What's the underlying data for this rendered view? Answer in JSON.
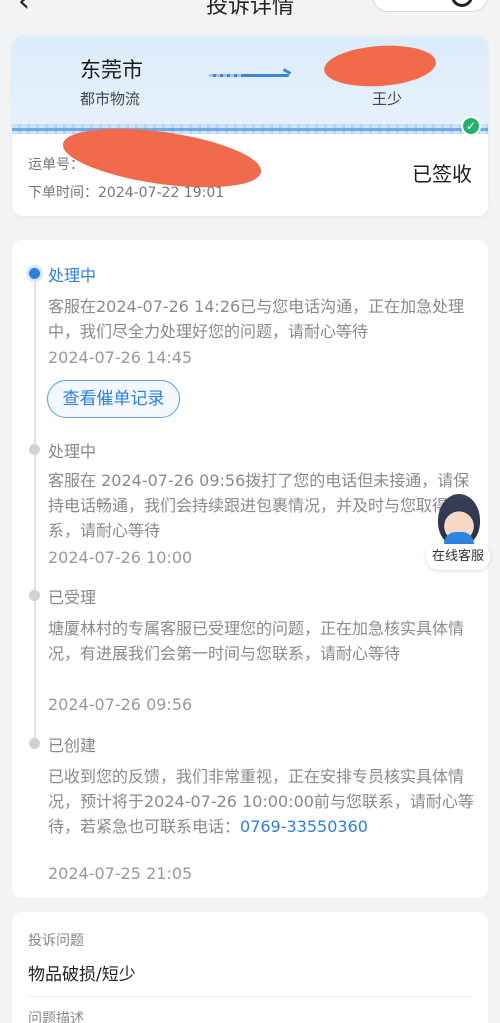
{
  "nav": {
    "title": "投诉详情"
  },
  "shipment": {
    "from_city": "东莞市",
    "from_sub": "都市物流",
    "to_name": "王少",
    "waybill_label": "运单号：",
    "order_time": "下单时间：2024-07-22 19:01",
    "status": "已签收"
  },
  "timeline": [
    {
      "title": "处理中",
      "desc": "客服在2024-07-26 14:26已与您电话沟通，正在加急处理中，我们尽全力处理好您的问题，请耐心等待",
      "time": "2024-07-26 14:45",
      "button": "查看催单记录",
      "active": true
    },
    {
      "title": "处理中",
      "desc": "客服在 2024-07-26 09:56拨打了您的电话但未接通，请保持电话畅通，我们会持续跟进包裹情况，并及时与您取得联系，请耐心等待",
      "time": "2024-07-26 10:00",
      "active": false
    },
    {
      "title": "已受理",
      "desc": "塘厦林村的专属客服已受理您的问题，正在加急核实具体情况，有进展我们会第一时间与您联系，请耐心等待",
      "time": "2024-07-26 09:56",
      "active": false
    },
    {
      "title": "已创建",
      "desc": "已收到您的反馈，我们非常重视，正在安排专员核实具体情况，预计将于2024-07-26 10:00:00前与您联系，请耐心等待，若紧急也可联系电话：",
      "phone": "0769-33550360",
      "time": "2024-07-25 21:05",
      "active": false
    }
  ],
  "service": {
    "label": "在线客服"
  },
  "complaint": {
    "issue_label": "投诉问题",
    "issue_value": "物品破损/短少",
    "desc_label": "问题描述"
  }
}
